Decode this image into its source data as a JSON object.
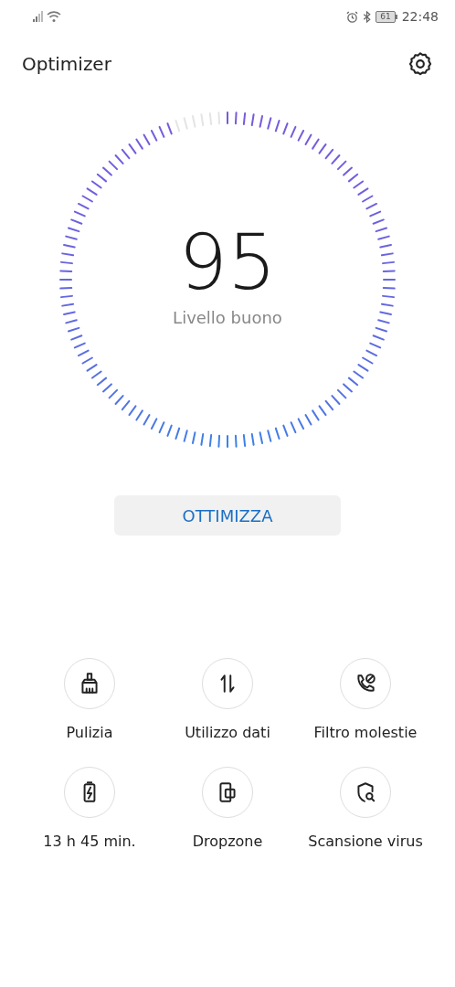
{
  "status_bar": {
    "battery": "61",
    "time": "22:48"
  },
  "header": {
    "title": "Optimizer"
  },
  "score": {
    "value": "95",
    "caption": "Livello buono"
  },
  "action_button": "OTTIMIZZA",
  "tools": [
    {
      "kind": "cleanup",
      "label": "Pulizia"
    },
    {
      "kind": "data",
      "label": "Utilizzo dati"
    },
    {
      "kind": "blocker",
      "label": "Filtro molestie"
    },
    {
      "kind": "battery",
      "label": "13 h 45 min."
    },
    {
      "kind": "dropzone",
      "label": "Dropzone"
    },
    {
      "kind": "virus",
      "label": "Scansione virus"
    }
  ]
}
